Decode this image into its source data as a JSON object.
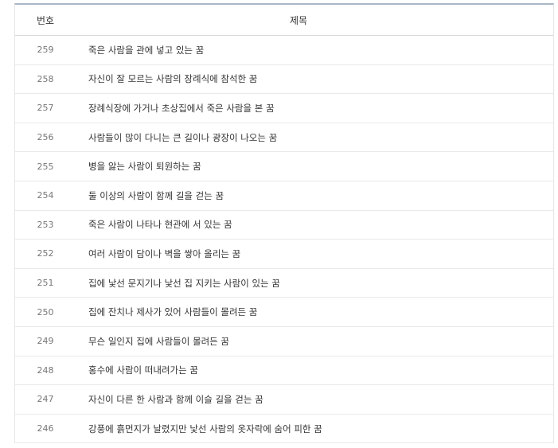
{
  "table": {
    "header": {
      "number": "번호",
      "title": "제목"
    },
    "rows": [
      {
        "number": "259",
        "title": "죽은 사람을 관에 넣고 있는 꿈"
      },
      {
        "number": "258",
        "title": "자신이 잘 모르는 사람의 장례식에 참석한 꿈"
      },
      {
        "number": "257",
        "title": "장례식장에 가거나 초상집에서 죽은 사람을 본 꿈"
      },
      {
        "number": "256",
        "title": "사람들이 많이 다니는 큰 길이나 광장이 나오는 꿈"
      },
      {
        "number": "255",
        "title": "병을 앓는 사람이 퇴원하는 꿈"
      },
      {
        "number": "254",
        "title": "둘 이상의 사람이 함께 길을 걷는 꿈"
      },
      {
        "number": "253",
        "title": "죽은 사람이 나타나 현관에 서 있는 꿈"
      },
      {
        "number": "252",
        "title": "여러 사람이 담이나 벽을 쌓아 올리는 꿈"
      },
      {
        "number": "251",
        "title": "집에 낯선 문지기나 낯선 집 지키는 사람이 있는 꿈"
      },
      {
        "number": "250",
        "title": "집에 잔치나 제사가 있어 사람들이 몰려든 꿈"
      },
      {
        "number": "249",
        "title": "무슨 일인지 집에 사람들이 몰려든 꿈"
      },
      {
        "number": "248",
        "title": "홍수에 사람이 떠내려가는 꿈"
      },
      {
        "number": "247",
        "title": "자신이 다른 한 사람과 함께 이슬 길을 걷는 꿈"
      },
      {
        "number": "246",
        "title": "강풍에 흙먼지가 날렸지만 낯선 사람의 옷자락에 숨어 피한 꿈"
      }
    ]
  }
}
